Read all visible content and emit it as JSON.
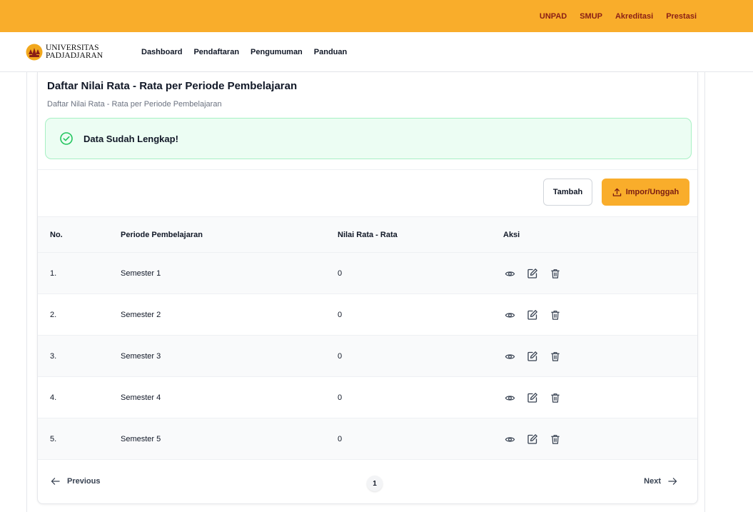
{
  "topbar": {
    "color": "#f9ad2b",
    "links": [
      "UNPAD",
      "SMUP",
      "Akreditasi",
      "Prestasi"
    ]
  },
  "navbar": {
    "logo": {
      "line1": "UNIVERSITAS",
      "line2": "PADJADJARAN"
    },
    "links": [
      "Dashboard",
      "Pendaftaran",
      "Pengumuman",
      "Panduan"
    ]
  },
  "card": {
    "title": "Daftar Nilai Rata - Rata per Periode Pembelajaran",
    "subtitle": "Daftar Nilai Rata - Rata per Periode Pembelajaran",
    "alert": {
      "text": "Data Sudah Lengkap!",
      "status_color": "#22c55e"
    },
    "buttons": {
      "add": "Tambah",
      "import": "Impor/Unggah"
    }
  },
  "table": {
    "headers": [
      "No.",
      "Periode Pembelajaran",
      "Nilai Rata - Rata",
      "Aksi"
    ],
    "rows": [
      {
        "no": "1.",
        "periode": "Semester 1",
        "nilai": "0"
      },
      {
        "no": "2.",
        "periode": "Semester 2",
        "nilai": "0"
      },
      {
        "no": "3.",
        "periode": "Semester 3",
        "nilai": "0"
      },
      {
        "no": "4.",
        "periode": "Semester 4",
        "nilai": "0"
      },
      {
        "no": "5.",
        "periode": "Semester 5",
        "nilai": "0"
      }
    ],
    "row_actions": [
      "eye-icon",
      "edit-icon",
      "trash-icon"
    ]
  },
  "pagination": {
    "previous": "Previous",
    "page": "1",
    "next": "Next"
  }
}
